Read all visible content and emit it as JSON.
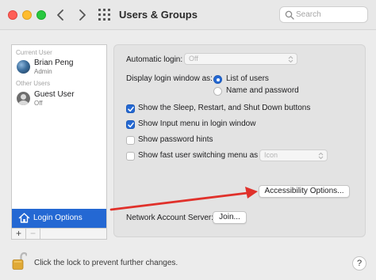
{
  "window": {
    "title": "Users & Groups",
    "search_placeholder": "Search"
  },
  "sidebar": {
    "current_user_label": "Current User",
    "other_users_label": "Other Users",
    "users": [
      {
        "name": "Brian Peng",
        "role": "Admin",
        "avatar": "profile-photo"
      },
      {
        "name": "Guest User",
        "role": "Off",
        "avatar": "person-silhouette-icon"
      }
    ],
    "login_options_label": "Login Options",
    "add_label": "+",
    "remove_label": "−"
  },
  "login_settings": {
    "automatic_login_label": "Automatic login:",
    "automatic_login_value": "Off",
    "display_window_label": "Display login window as:",
    "display_options": [
      {
        "label": "List of users",
        "selected": true
      },
      {
        "label": "Name and password",
        "selected": false
      }
    ],
    "checkboxes": [
      {
        "label": "Show the Sleep, Restart, and Shut Down buttons",
        "checked": true
      },
      {
        "label": "Show Input menu in login window",
        "checked": true
      },
      {
        "label": "Show password hints",
        "checked": false
      },
      {
        "label": "Show fast user switching menu as",
        "checked": false
      }
    ],
    "fast_switch_value": "Icon",
    "accessibility_button": "Accessibility Options...",
    "network_server_label": "Network Account Server:",
    "join_button": "Join..."
  },
  "footer": {
    "lock_text": "Click the lock to prevent further changes.",
    "help_label": "?"
  },
  "colors": {
    "accent": "#2468d3",
    "annotation_arrow": "#e0312b"
  }
}
